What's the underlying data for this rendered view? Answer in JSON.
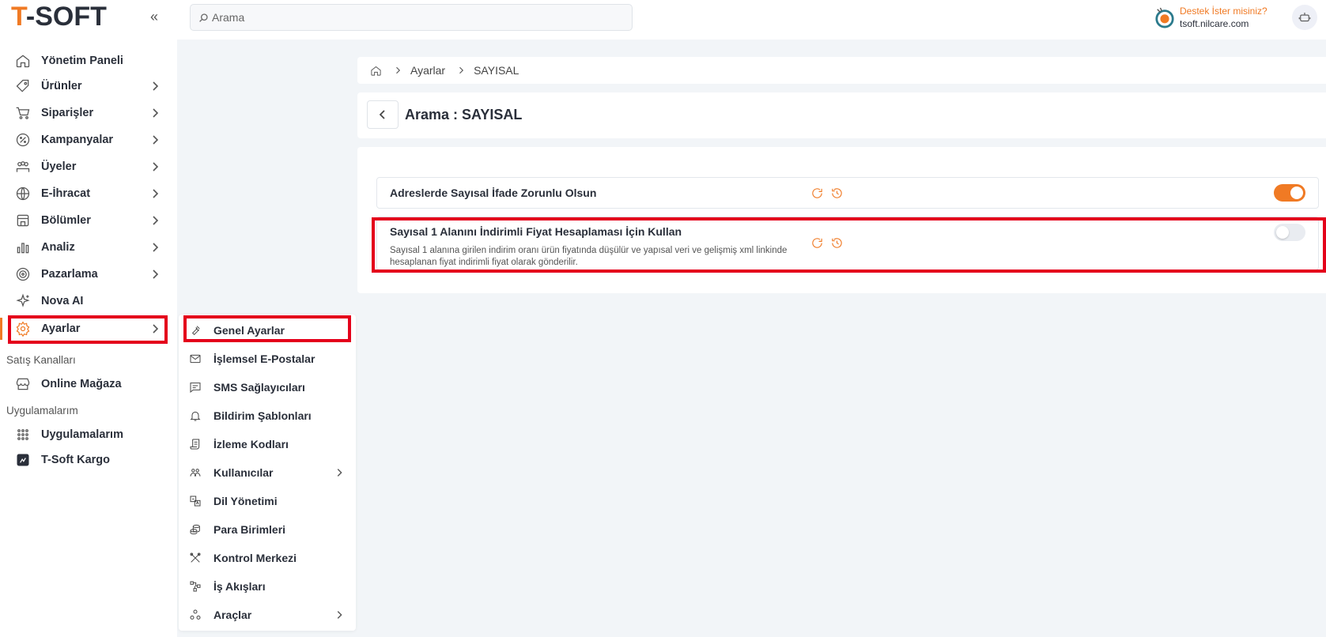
{
  "brand": {
    "logo_first": "T",
    "logo_rest": "-SOFT",
    "accent": "#f07a24",
    "highlight": "#e4001b"
  },
  "topbar": {
    "search_placeholder": "Arama",
    "support_question": "Destek İster misiniz?",
    "support_domain": "tsoft.nilcare.com"
  },
  "sidebar": {
    "items": [
      {
        "label": "Yönetim Paneli",
        "icon": "home-icon",
        "has_children": false
      },
      {
        "label": "Ürünler",
        "icon": "tag-icon",
        "has_children": true
      },
      {
        "label": "Siparişler",
        "icon": "cart-icon",
        "has_children": true
      },
      {
        "label": "Kampanyalar",
        "icon": "percent-icon",
        "has_children": true
      },
      {
        "label": "Üyeler",
        "icon": "users-icon",
        "has_children": true
      },
      {
        "label": "E-İhracat",
        "icon": "globe-icon",
        "has_children": true
      },
      {
        "label": "Bölümler",
        "icon": "store-icon",
        "has_children": true
      },
      {
        "label": "Analiz",
        "icon": "chart-icon",
        "has_children": true
      },
      {
        "label": "Pazarlama",
        "icon": "target-icon",
        "has_children": true
      },
      {
        "label": "Nova AI",
        "icon": "sparkle-icon",
        "has_children": false
      },
      {
        "label": "Ayarlar",
        "icon": "gear-icon",
        "has_children": true,
        "active": true
      }
    ],
    "section_sales": "Satış Kanalları",
    "online_store": "Online Mağaza",
    "section_apps": "Uygulamalarım",
    "apps": "Uygulamalarım",
    "kargo": "T-Soft Kargo"
  },
  "submenu": {
    "items": [
      {
        "label": "Genel Ayarlar",
        "icon": "wrench-icon"
      },
      {
        "label": "İşlemsel E-Postalar",
        "icon": "mail-icon"
      },
      {
        "label": "SMS Sağlayıcıları",
        "icon": "message-icon"
      },
      {
        "label": "Bildirim Şablonları",
        "icon": "bell-icon"
      },
      {
        "label": "İzleme Kodları",
        "icon": "script-icon"
      },
      {
        "label": "Kullanıcılar",
        "icon": "team-icon",
        "has_children": true
      },
      {
        "label": "Dil Yönetimi",
        "icon": "translate-icon"
      },
      {
        "label": "Para Birimleri",
        "icon": "coins-icon"
      },
      {
        "label": "Kontrol Merkezi",
        "icon": "tools-icon"
      },
      {
        "label": "İş Akışları",
        "icon": "workflow-icon"
      },
      {
        "label": "Araçlar",
        "icon": "shapes-icon",
        "has_children": true
      }
    ]
  },
  "breadcrumb": {
    "level1": "Ayarlar",
    "level2": "SAYISAL"
  },
  "page": {
    "title": "Arama : SAYISAL"
  },
  "settings": [
    {
      "label": "Adreslerde Sayısal İfade Zorunlu Olsun",
      "desc": "",
      "enabled": true
    },
    {
      "label": "Sayısal 1 Alanını İndirimli Fiyat Hesaplaması İçin Kullan",
      "desc": "Sayısal 1 alanına girilen indirim oranı ürün fiyatında düşülür ve yapısal veri ve gelişmiş xml linkinde hesaplanan fiyat indirimli fiyat olarak gönderilir.",
      "enabled": false
    }
  ]
}
